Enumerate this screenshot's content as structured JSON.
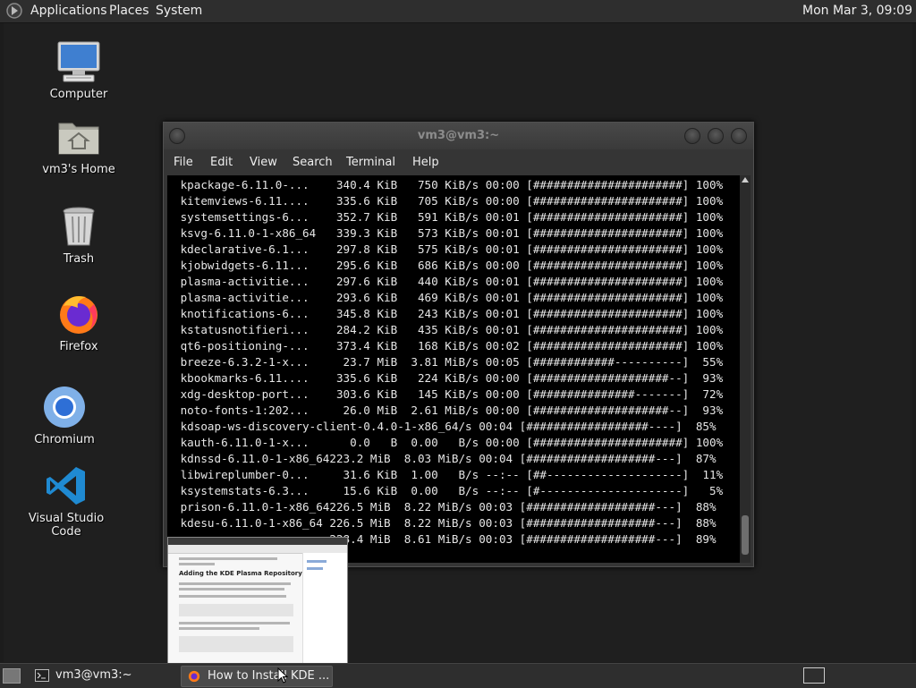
{
  "top_panel": {
    "menus": [
      "Applications",
      "Places",
      "System"
    ],
    "clock": "Mon Mar  3, 09:09"
  },
  "desktop_icons": [
    {
      "label": "Computer",
      "icon": "computer-icon"
    },
    {
      "label": "vm3's Home",
      "icon": "home-folder-icon"
    },
    {
      "label": "Trash",
      "icon": "trash-icon"
    },
    {
      "label": "Firefox",
      "icon": "firefox-icon"
    },
    {
      "label": "Chromium",
      "icon": "chromium-icon"
    },
    {
      "label": "Visual Studio Code",
      "icon": "vscode-icon"
    }
  ],
  "terminal": {
    "title": "vm3@vm3:~",
    "menu": [
      "File",
      "Edit",
      "View",
      "Search",
      "Terminal",
      "Help"
    ],
    "lines": [
      " kpackage-6.11.0-...    340.4 KiB   750 KiB/s 00:00 [######################] 100%",
      " kitemviews-6.11....    335.6 KiB   705 KiB/s 00:00 [######################] 100%",
      " systemsettings-6...    352.7 KiB   591 KiB/s 00:01 [######################] 100%",
      " ksvg-6.11.0-1-x86_64   339.3 KiB   573 KiB/s 00:01 [######################] 100%",
      " kdeclarative-6.1...    297.8 KiB   575 KiB/s 00:01 [######################] 100%",
      " kjobwidgets-6.11...    295.6 KiB   686 KiB/s 00:00 [######################] 100%",
      " plasma-activitie...    297.6 KiB   440 KiB/s 00:01 [######################] 100%",
      " plasma-activitie...    293.6 KiB   469 KiB/s 00:01 [######################] 100%",
      " knotifications-6...    345.8 KiB   243 KiB/s 00:01 [######################] 100%",
      " kstatusnotifieri...    284.2 KiB   435 KiB/s 00:01 [######################] 100%",
      " qt6-positioning-...    373.4 KiB   168 KiB/s 00:02 [######################] 100%",
      " breeze-6.3.2-1-x...     23.7 MiB  3.81 MiB/s 00:05 [############----------]  55%",
      " kbookmarks-6.11....    335.6 KiB   224 KiB/s 00:00 [####################--]  93%",
      " xdg-desktop-port...    303.6 KiB   145 KiB/s 00:00 [###############-------]  72%",
      " noto-fonts-1:202...     26.0 MiB  2.61 MiB/s 00:00 [####################--]  93%",
      " kdsoap-ws-discovery-client-0.4.0-1-x86_64/s 00:04 [##################----]  85%",
      " kauth-6.11.0-1-x...      0.0   B  0.00   B/s 00:00 [######################] 100%",
      " kdnssd-6.11.0-1-x86_64223.2 MiB  8.03 MiB/s 00:04 [###################---]  87%",
      " libwireplumber-0...     31.6 KiB  1.00   B/s --:-- [##--------------------]  11%",
      " ksystemstats-6.3...     15.6 KiB  0.00   B/s --:-- [#---------------------]   5%",
      " prison-6.11.0-1-x86_64226.5 MiB  8.22 MiB/s 00:03 [###################---]  88%",
      " kdesu-6.11.0-1-x86_64 226.5 MiB  8.22 MiB/s 00:03 [###################---]  88%",
      "                       228.4 MiB  8.61 MiB/s 00:03 [###################---]  89%"
    ]
  },
  "firefox_preview": {
    "heading": "Adding the KDE Plasma Repository"
  },
  "taskbar": {
    "tasks": [
      {
        "label": "vm3@vm3:~",
        "icon": "terminal-icon",
        "active": false
      },
      {
        "label": "How to Install KDE ...",
        "icon": "firefox-icon",
        "active": true
      }
    ]
  },
  "colors": {
    "panel_bg": "#2e2e2e",
    "desktop_bg": "#1f1f1f",
    "terminal_bg": "#000000",
    "terminal_fg": "#e6e6e6"
  }
}
